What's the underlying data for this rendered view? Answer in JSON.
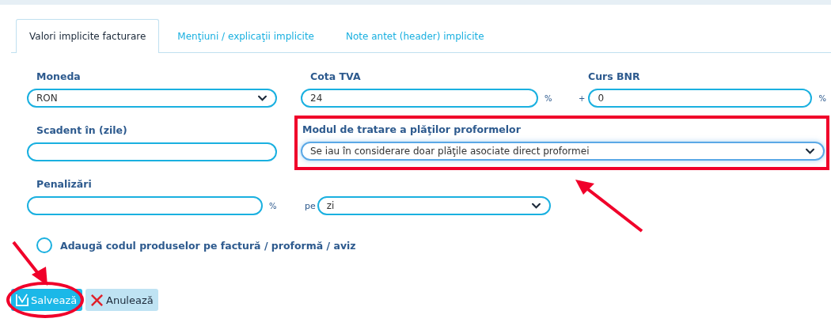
{
  "tabs": [
    {
      "label": "Valori implicite facturare",
      "selected": true
    },
    {
      "label": "Menţiuni / explicaţii implicite",
      "selected": false
    },
    {
      "label": "Note antet (header) implicite",
      "selected": false
    }
  ],
  "rows": [
    {
      "fields": [
        {
          "label": "Moneda",
          "kind": "select",
          "value": "RON"
        },
        {
          "label": "Cota TVA",
          "kind": "input",
          "value": "24",
          "suffix": "%"
        },
        {
          "label": "Curs BNR",
          "kind": "input",
          "value": "0",
          "prefix": "+",
          "suffix": "%"
        }
      ]
    },
    {
      "fields": [
        {
          "label": "Scadent în (zile)",
          "kind": "input"
        },
        {
          "label": "Modul de tratare a plăţilor proformelor",
          "kind": "select",
          "value": "Se iau în considerare doar plăţile asociate direct proformei",
          "highlighted": true
        }
      ]
    },
    {
      "fields": [
        {
          "label": "Penalizări",
          "kind": "input",
          "suffix": "%"
        },
        {
          "kind": "select",
          "value": "zi",
          "prefix": "pe"
        }
      ]
    }
  ],
  "checkbox": {
    "label": "Adaugă codul produselor pe factură / proformă / aviz",
    "checked": false
  },
  "buttons": [
    {
      "label": "Salvează",
      "kind": "save",
      "highlighted": true
    },
    {
      "label": "Anulează",
      "kind": "cancel"
    }
  ]
}
